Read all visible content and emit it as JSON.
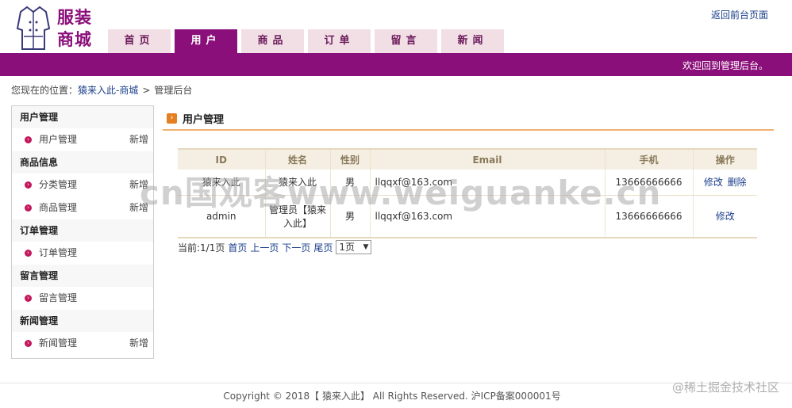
{
  "logo": {
    "line1": "服装",
    "line2": "商城"
  },
  "nav": {
    "tabs": [
      {
        "label": "首页",
        "active": false
      },
      {
        "label": "用户",
        "active": true
      },
      {
        "label": "商品",
        "active": false
      },
      {
        "label": "订单",
        "active": false
      },
      {
        "label": "留言",
        "active": false
      },
      {
        "label": "新闻",
        "active": false
      }
    ],
    "back_link": "返回前台页面",
    "welcome": "欢迎回到管理后台。"
  },
  "breadcrumb": {
    "prefix": "您现在的位置：",
    "site": "猿来入此-商城",
    "sep": ">",
    "current": "管理后台"
  },
  "sidebar": {
    "groups": [
      {
        "title": "用户管理",
        "items": [
          {
            "label": "用户管理",
            "add": "新增"
          }
        ]
      },
      {
        "title": "商品信息",
        "items": [
          {
            "label": "分类管理",
            "add": "新增"
          },
          {
            "label": "商品管理",
            "add": "新增"
          }
        ]
      },
      {
        "title": "订单管理",
        "items": [
          {
            "label": "订单管理",
            "add": ""
          }
        ]
      },
      {
        "title": "留言管理",
        "items": [
          {
            "label": "留言管理",
            "add": ""
          }
        ]
      },
      {
        "title": "新闻管理",
        "items": [
          {
            "label": "新闻管理",
            "add": "新增"
          }
        ]
      }
    ]
  },
  "main": {
    "title": "用户管理",
    "table": {
      "headers": [
        "ID",
        "姓名",
        "性别",
        "Email",
        "手机",
        "操作"
      ],
      "rows": [
        {
          "id": "猿来入此",
          "name": "猿来入此",
          "gender": "男",
          "email": "llqqxf@163.com",
          "phone": "13666666666",
          "edit": "修改",
          "delete": "删除"
        },
        {
          "id": "admin",
          "name": "管理员【猿来入此】",
          "gender": "男",
          "email": "llqqxf@163.com",
          "phone": "13666666666",
          "edit": "修改",
          "delete": ""
        }
      ]
    },
    "pager": {
      "current": "当前:1/1页",
      "first": "首页",
      "prev": "上一页",
      "next": "下一页",
      "last": "尾页",
      "select_value": "1页"
    }
  },
  "watermark": "cn国观客www.weiguanke.cn",
  "footer": {
    "copyright": "Copyright © 2018【 猿来入此】 All Rights Reserved. 沪ICP备案000001号",
    "corner": "@稀土掘金技术社区"
  },
  "colors": {
    "brand": "#8b0f7a",
    "tab_bg": "#f2dfe6",
    "accent_line": "#f0b070",
    "link": "#1a3e8a"
  }
}
